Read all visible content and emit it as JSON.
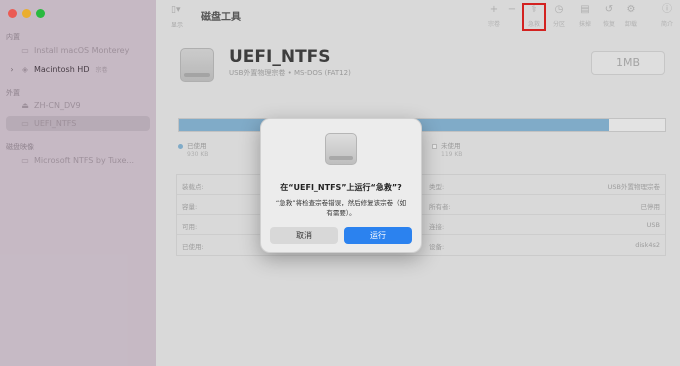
{
  "app": {
    "title": "磁盘工具"
  },
  "colors": {
    "close": "#ff5f57",
    "minimize": "#febc2e",
    "zoom": "#28c840",
    "accent": "#2b82ef",
    "used": "#88b8d8",
    "free": "#ffffff",
    "highlight": "#e5201d"
  },
  "sidebar": {
    "internal_header": "内置",
    "external_header": "外置",
    "images_header": "磁盘映像",
    "items": [
      {
        "label": "Install macOS Monterey",
        "icon": "disk-icon"
      },
      {
        "label": "Macintosh HD",
        "tag": "宗卷",
        "icon": "layers-icon"
      },
      {
        "label": "ZH-CN_DV9",
        "icon": "eject-icon"
      },
      {
        "label": "UEFI_NTFS",
        "icon": "usb-disk-icon"
      },
      {
        "label": "Microsoft NTFS by Tuxe...",
        "icon": "disk-icon"
      }
    ]
  },
  "toolbar": {
    "view_label": "显示",
    "view_icon": "sidebar-icon",
    "buttons": [
      {
        "glyph": "+",
        "label": "宗卷",
        "icon": "plus-icon"
      },
      {
        "glyph": "−",
        "label": "",
        "icon": "minus-icon"
      },
      {
        "glyph": "⚕",
        "label": "急救",
        "icon": "first-aid-icon"
      },
      {
        "glyph": "◷",
        "label": "分区",
        "icon": "partition-icon"
      },
      {
        "glyph": "▤",
        "label": "抹掉",
        "icon": "erase-icon"
      },
      {
        "glyph": "↺",
        "label": "恢复",
        "icon": "restore-icon"
      },
      {
        "glyph": "⚙",
        "label": "卸载",
        "icon": "unmount-icon"
      },
      {
        "glyph": "ⓘ",
        "label": "简介",
        "icon": "info-icon"
      }
    ]
  },
  "volume": {
    "name": "UEFI_NTFS",
    "subtitle": "USB外置物理宗卷 • MS-DOS (FAT12)",
    "size": "1MB",
    "used_fraction": 0.885,
    "used_label": "已使用",
    "used_value": "930 KB",
    "free_label": "未使用",
    "free_value": "119 KB"
  },
  "info_rows": [
    {
      "label_left": "装载点:",
      "value_left": "",
      "label_right": "类型:",
      "value_right": "USB外置物理宗卷"
    },
    {
      "label_left": "容量:",
      "value_left": "",
      "label_right": "所有者:",
      "value_right": "已停用"
    },
    {
      "label_left": "可用:",
      "value_left": "",
      "label_right": "连接:",
      "value_right": "USB"
    },
    {
      "label_left": "已使用:",
      "value_left": "",
      "label_right": "设备:",
      "value_right": "disk4s2"
    }
  ],
  "dialog": {
    "title": "在“UEFI_NTFS”上运行“急救”?",
    "message": "“急救”将检查宗卷错误，然后修复该宗卷（如有需要）。",
    "cancel": "取消",
    "run": "运行"
  }
}
